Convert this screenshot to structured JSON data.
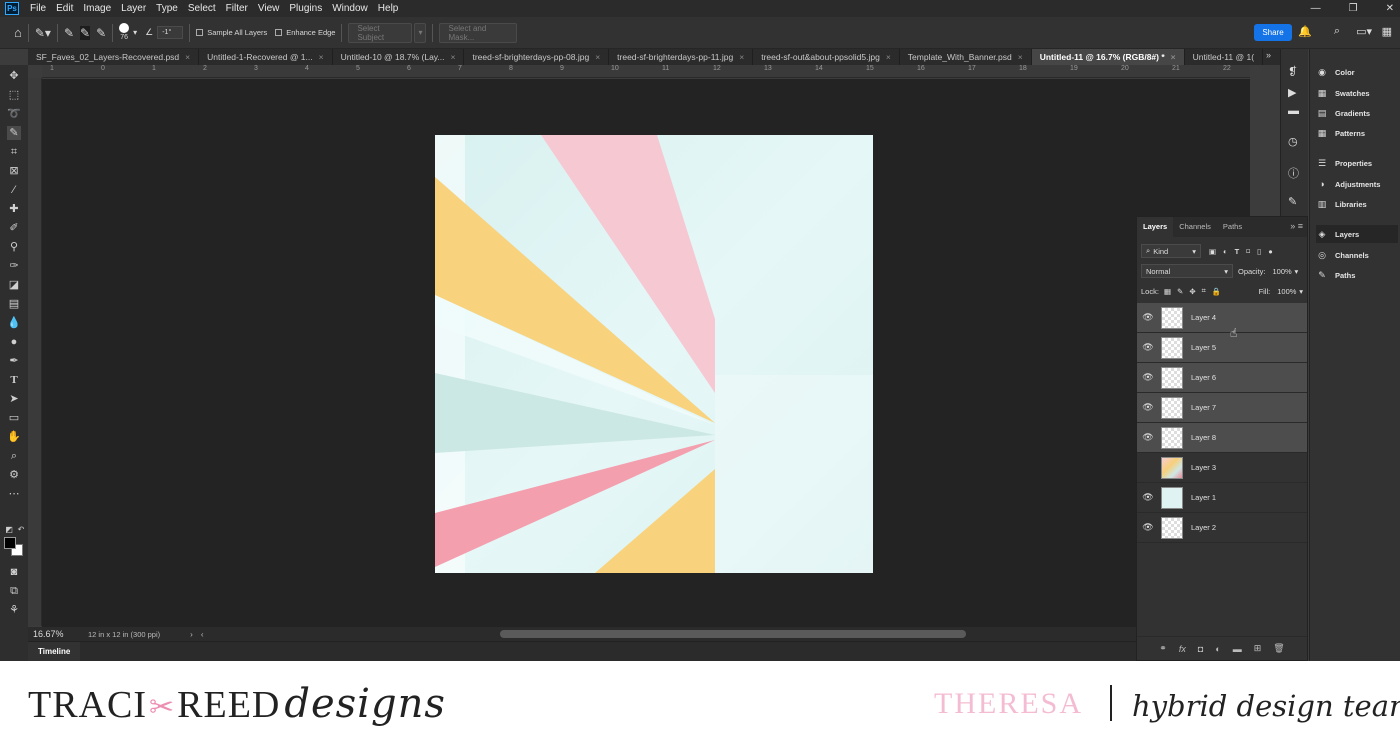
{
  "menu": [
    "File",
    "Edit",
    "Image",
    "Layer",
    "Type",
    "Select",
    "Filter",
    "View",
    "Plugins",
    "Window",
    "Help"
  ],
  "app_logo": "Ps",
  "options": {
    "brush_size": "76",
    "angle": "-1°",
    "sample_all_layers": "Sample All Layers",
    "enhance_edge": "Enhance Edge",
    "select_subject": "Select Subject",
    "select_and_mask": "Select and Mask...",
    "share": "Share"
  },
  "tabs": [
    "SF_Faves_02_Layers-Recovered.psd",
    "Untitled-1-Recovered @ 1...",
    "Untitled-10 @ 18.7% (Lay...",
    "treed-sf-brighterdays-pp-08.jpg",
    "treed-sf-brighterdays-pp-11.jpg",
    "treed-sf-out&about-ppsolid5.jpg",
    "Template_With_Banner.psd",
    "Untitled-11 @ 16.7% (RGB/8#) *",
    "Untitled-11 @ 1("
  ],
  "ruler": [
    "1",
    "0",
    "1",
    "2",
    "3",
    "4",
    "5",
    "6",
    "7",
    "8",
    "9",
    "10",
    "11",
    "12",
    "13",
    "14",
    "15",
    "16",
    "17",
    "18",
    "19",
    "20",
    "21",
    "22"
  ],
  "status": {
    "zoom": "16.67%",
    "doc_info": "12 in x 12 in (300 ppi)"
  },
  "timeline": "Timeline",
  "dock": [
    {
      "icon": "color-icon",
      "label": "Color"
    },
    {
      "icon": "swatches-icon",
      "label": "Swatches"
    },
    {
      "icon": "gradients-icon",
      "label": "Gradients"
    },
    {
      "icon": "patterns-icon",
      "label": "Patterns"
    },
    {
      "icon": "properties-icon",
      "label": "Properties"
    },
    {
      "icon": "adjustments-icon",
      "label": "Adjustments"
    },
    {
      "icon": "libraries-icon",
      "label": "Libraries"
    },
    {
      "icon": "layers-icon",
      "label": "Layers"
    },
    {
      "icon": "channels-icon",
      "label": "Channels"
    },
    {
      "icon": "paths-icon",
      "label": "Paths"
    }
  ],
  "layers_panel": {
    "tabs": [
      "Layers",
      "Channels",
      "Paths"
    ],
    "filter": "Kind",
    "blend_mode": "Normal",
    "opacity_label": "Opacity:",
    "opacity": "100%",
    "lock_label": "Lock:",
    "fill_label": "Fill:",
    "fill": "100%",
    "layers": [
      {
        "name": "Layer 4",
        "visible": true,
        "selected": true,
        "thumb": "checker"
      },
      {
        "name": "Layer 5",
        "visible": true,
        "selected": true,
        "thumb": "checker"
      },
      {
        "name": "Layer 6",
        "visible": true,
        "selected": true,
        "thumb": "checker"
      },
      {
        "name": "Layer 7",
        "visible": true,
        "selected": true,
        "thumb": "checker"
      },
      {
        "name": "Layer 8",
        "visible": true,
        "selected": true,
        "thumb": "checker"
      },
      {
        "name": "Layer 3",
        "visible": false,
        "selected": false,
        "thumb": "rays"
      },
      {
        "name": "Layer 1",
        "visible": true,
        "selected": false,
        "thumb": "blue"
      },
      {
        "name": "Layer 2",
        "visible": true,
        "selected": false,
        "thumb": "checker"
      }
    ]
  },
  "brand": {
    "part1": "TRACI",
    "part2": "REED",
    "script": "designs",
    "member": "THERESA",
    "team": "hybrid design team"
  },
  "colors": {
    "pink": "#f6c8d2",
    "yellow": "#f8d27c",
    "mint": "#cce8e5",
    "coral": "#f49fae",
    "paper": "#e2f5f5",
    "accent_pink": "#f4bcd2"
  }
}
